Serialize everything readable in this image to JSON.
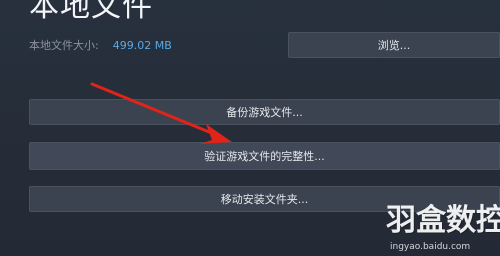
{
  "header": {
    "title": "本地文件"
  },
  "local_files": {
    "size_label": "本地文件大小:",
    "size_value": "499.02 MB"
  },
  "buttons": {
    "browse": "浏览...",
    "backup": "备份游戏文件...",
    "verify": "验证游戏文件的完整性...",
    "move": "移动安装文件夹..."
  },
  "watermark": {
    "logo_text": "羽盒数控",
    "site_text": "ingyao.baidu.com"
  },
  "colors": {
    "background": "#262c38",
    "button": "#3b4350",
    "accent_value": "#5aa9e6",
    "annotation_arrow": "#e0241a"
  }
}
